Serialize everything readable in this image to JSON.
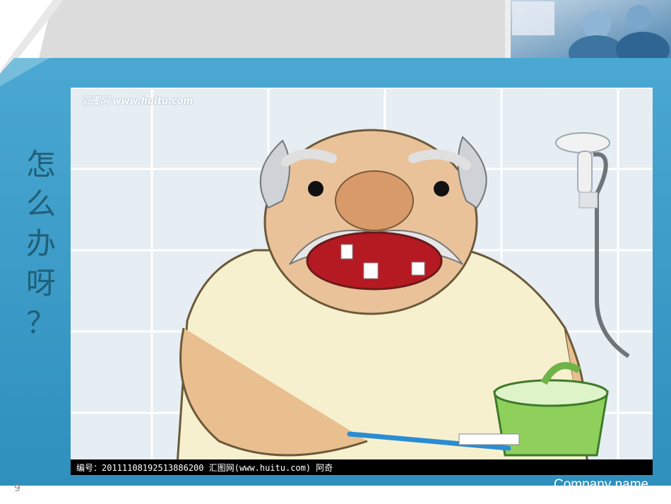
{
  "slide": {
    "side_title_chars": [
      "怎",
      "么",
      "办",
      "呀",
      "？"
    ],
    "page_number": "9",
    "company_name": "Company name"
  },
  "image": {
    "watermark_top": "汇图网 www.huitu.com",
    "caption": "编号：20111108192513886200  汇图网(www.huitu.com) 阿奇"
  },
  "colors": {
    "frame_blue": "#3a9cc9",
    "title_text": "#1f5f78"
  }
}
